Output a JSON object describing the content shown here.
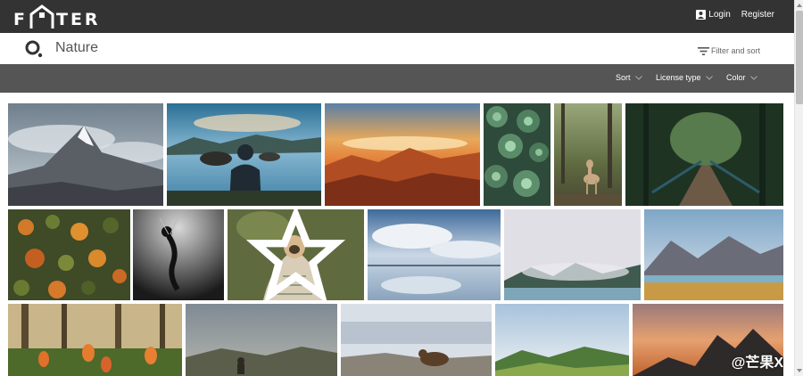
{
  "header": {
    "logo_text_left": "F",
    "logo_text_right": "TER",
    "login_label": "Login",
    "register_label": "Register"
  },
  "search": {
    "query": "Nature",
    "filter_label": "Filter and sort"
  },
  "filters": {
    "sort_label": "Sort",
    "license_label": "License type",
    "color_label": "Color"
  },
  "photos": [
    {
      "name": "mountain-peak-clouds",
      "subject": "snowy mountain peak"
    },
    {
      "name": "man-at-mountain-lake",
      "subject": "man at mountain lake"
    },
    {
      "name": "sunset-over-mountains",
      "subject": "sunset above clouds"
    },
    {
      "name": "green-succulents",
      "subject": "succulent plants"
    },
    {
      "name": "deer-in-forest",
      "subject": "fawn in forest"
    },
    {
      "name": "forest-bridge",
      "subject": "bridge through forest"
    },
    {
      "name": "autumn-forest-aerial",
      "subject": "aerial autumn forest"
    },
    {
      "name": "underwater-person-bw",
      "subject": "person underwater"
    },
    {
      "name": "dog-in-blanket",
      "subject": "pug wrapped in blanket"
    },
    {
      "name": "cloudy-sky-reflection",
      "subject": "cloud reflection"
    },
    {
      "name": "foggy-lake-shore",
      "subject": "fog over lake"
    },
    {
      "name": "desert-mountain-lake",
      "subject": "mountain lake desert"
    },
    {
      "name": "tulips-in-forest",
      "subject": "orange tulips"
    },
    {
      "name": "foggy-hills-person",
      "subject": "person in misty hills"
    },
    {
      "name": "bear-in-snow",
      "subject": "bear on snowy ground"
    },
    {
      "name": "green-rolling-hills",
      "subject": "green hills"
    },
    {
      "name": "orange-sunset-peaks",
      "subject": "sunset mountain silhouette"
    }
  ],
  "watermark": "@芒果X",
  "colors": {
    "topbar": "#333333",
    "filterbar": "#555555",
    "scroll_thumb": "#c1c1c1"
  }
}
